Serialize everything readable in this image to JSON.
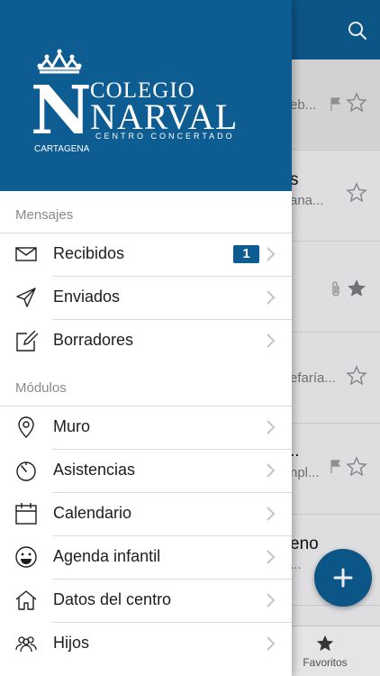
{
  "drawer": {
    "logo": {
      "name_line1": "COLEGIO",
      "name_line2": "NARVAL",
      "tagline": "CENTRO CONCERTADO",
      "city": "CARTAGENA",
      "monogram": "N"
    },
    "sections": {
      "messages_title": "Mensajes",
      "modules_title": "Módulos"
    },
    "messages": [
      {
        "label": "Recibidos",
        "icon": "envelope-icon",
        "badge": "1"
      },
      {
        "label": "Enviados",
        "icon": "paper-plane-icon"
      },
      {
        "label": "Borradores",
        "icon": "compose-icon"
      }
    ],
    "modules": [
      {
        "label": "Muro",
        "icon": "location-pin-icon"
      },
      {
        "label": "Asistencias",
        "icon": "stopwatch-icon"
      },
      {
        "label": "Calendario",
        "icon": "calendar-icon"
      },
      {
        "label": "Agenda infantil",
        "icon": "smiley-icon"
      },
      {
        "label": "Datos del centro",
        "icon": "house-icon"
      },
      {
        "label": "Hijos",
        "icon": "people-icon"
      }
    ]
  },
  "background": {
    "rows": [
      {
        "line1": "",
        "line2": "eb...",
        "flag": true,
        "star": "outline"
      },
      {
        "line1": "s",
        "line2": "ana...",
        "flag": false,
        "star": "outline"
      },
      {
        "line1": "",
        "line2": "",
        "attachment": true,
        "star": "filled"
      },
      {
        "line1": "",
        "line2": "efaría...",
        "flag": false,
        "star": "outline"
      },
      {
        "line1": "..",
        "line2": "npl...",
        "flag": true,
        "star": "outline"
      },
      {
        "line1": "eno",
        "line2": "...",
        "flag": false,
        "star": "outline"
      }
    ],
    "tabbar": {
      "favorites_label": "Favoritos"
    }
  },
  "colors": {
    "brand": "#0d5c92",
    "badge": "#0d5c92"
  }
}
